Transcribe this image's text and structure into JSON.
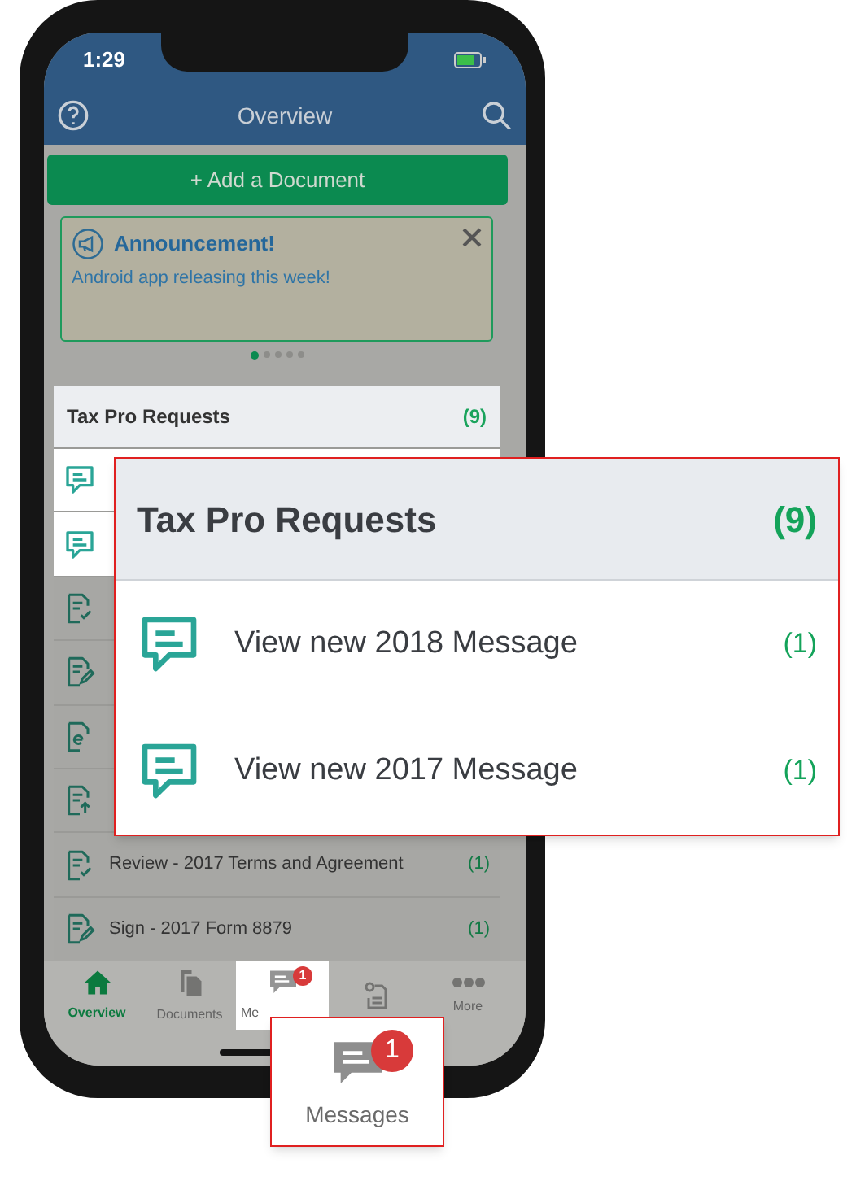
{
  "status_bar": {
    "time": "1:29"
  },
  "header": {
    "title": "Overview"
  },
  "add_button": {
    "label": "+ Add a Document"
  },
  "announcement": {
    "title": "Announcement!",
    "text": "Android app releasing this week!"
  },
  "carousel": [
    {
      "selected": true
    },
    {
      "selected": false
    },
    {
      "selected": false
    },
    {
      "selected": false
    },
    {
      "selected": false
    }
  ],
  "requests": {
    "title": "Tax Pro Requests",
    "count": "(9)",
    "spotlight": true,
    "rows": [
      {
        "kind": "message",
        "spotlight": true
      },
      {
        "kind": "message",
        "spotlight": true
      },
      {
        "kind": "review",
        "spotlight": false
      },
      {
        "kind": "sign",
        "spotlight": false
      },
      {
        "kind": "electronic",
        "spotlight": false
      },
      {
        "kind": "upload",
        "spotlight": false
      },
      {
        "kind": "review",
        "spotlight": false,
        "label": "Review - 2017 Terms and Agreement",
        "count": "(1)"
      },
      {
        "kind": "sign",
        "spotlight": false,
        "label": "Sign - 2017 Form 8879",
        "count": "(1)"
      }
    ]
  },
  "tabs": [
    {
      "kind": "home",
      "label": "Overview",
      "selected": true,
      "spotlight": false
    },
    {
      "kind": "documents",
      "label": "Documents",
      "selected": false,
      "spotlight": false
    },
    {
      "kind": "messages",
      "label": "Me",
      "selected": false,
      "spotlight": true,
      "badge": "1"
    },
    {
      "kind": "tax-return",
      "selected": false,
      "spotlight": false
    },
    {
      "kind": "more",
      "label": "More",
      "selected": false,
      "spotlight": false
    }
  ],
  "requests_callout": {
    "title": "Tax Pro Requests",
    "count": "(9)",
    "rows": [
      {
        "label": "View new 2018 Message",
        "count": "(1)"
      },
      {
        "label": "View new 2017 Message",
        "count": "(1)"
      }
    ]
  },
  "messages_callout": {
    "label": "Messages",
    "badge": "1"
  }
}
